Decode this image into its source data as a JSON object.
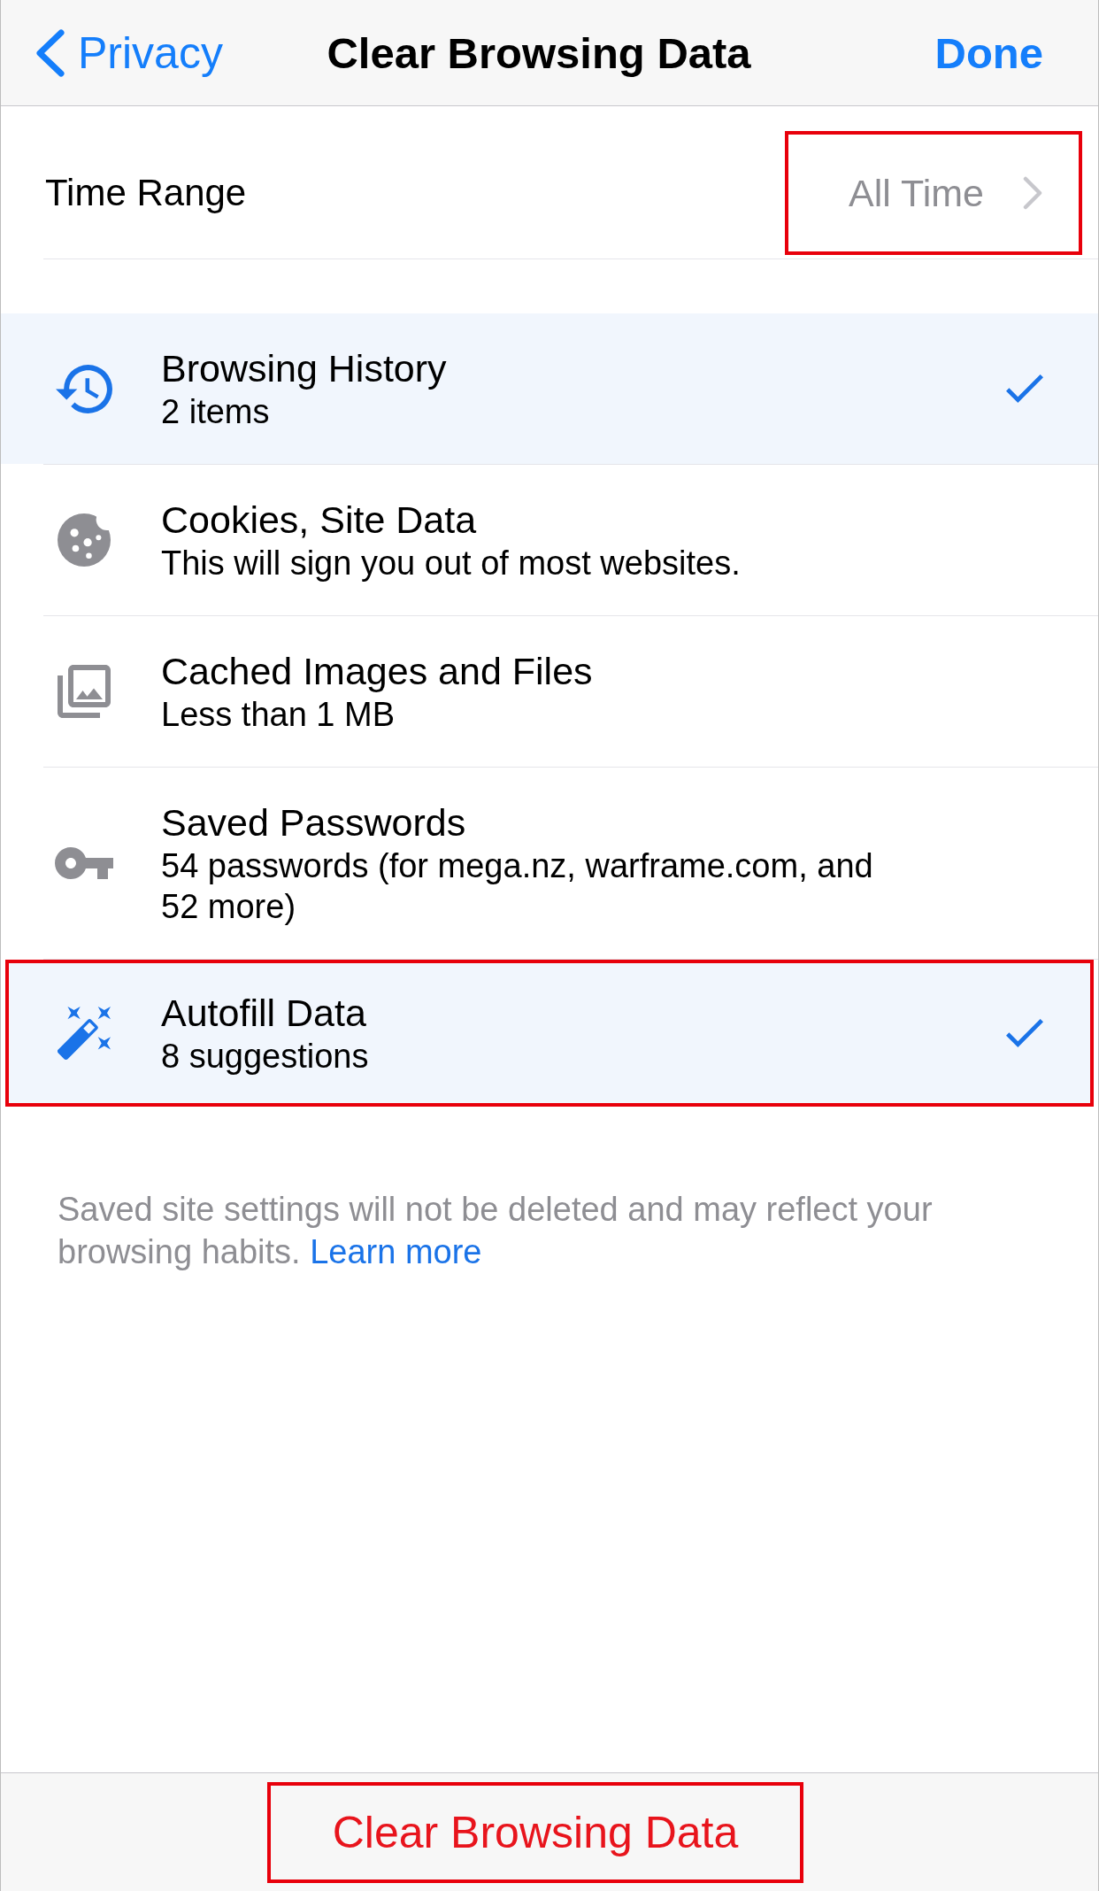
{
  "nav": {
    "back_label": "Privacy",
    "title": "Clear Browsing Data",
    "done_label": "Done"
  },
  "time_range": {
    "label": "Time Range",
    "value": "All Time",
    "highlighted": true
  },
  "items": [
    {
      "kind": "history",
      "title": "Browsing History",
      "subtitle": "2 items",
      "selected": true,
      "highlighted": false
    },
    {
      "kind": "cookies",
      "title": "Cookies, Site Data",
      "subtitle": "This will sign you out of most websites.",
      "selected": false,
      "highlighted": false
    },
    {
      "kind": "cache",
      "title": "Cached Images and Files",
      "subtitle": "Less than 1 MB",
      "selected": false,
      "highlighted": false
    },
    {
      "kind": "passwords",
      "title": "Saved Passwords",
      "subtitle": "54 passwords (for mega.nz, warframe.com, and 52 more)",
      "selected": false,
      "highlighted": false
    },
    {
      "kind": "autofill",
      "title": "Autofill Data",
      "subtitle": "8 suggestions",
      "selected": true,
      "highlighted": true
    }
  ],
  "footer": {
    "text": "Saved site settings will not be deleted and may reflect your browsing habits.",
    "link": "Learn more"
  },
  "clear_button": {
    "label": "Clear Browsing Data",
    "highlighted": true
  }
}
